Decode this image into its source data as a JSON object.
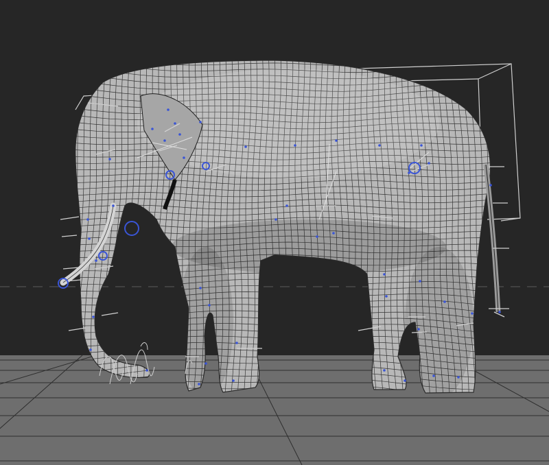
{
  "viewport": {
    "background": "#262626",
    "ground_color": "#6e6e6e",
    "grid_line_color": "#2a2a2a",
    "horizon_color": "#4a4a4a",
    "mesh_fill": "#b9b9b9",
    "mesh_line": "#202020",
    "rig_color": "#d8d8d8",
    "control_color": "#3a55d6"
  },
  "scene": {
    "model": "elephant-mesh",
    "bounding_box": "shown",
    "rig_controls": "shown"
  }
}
